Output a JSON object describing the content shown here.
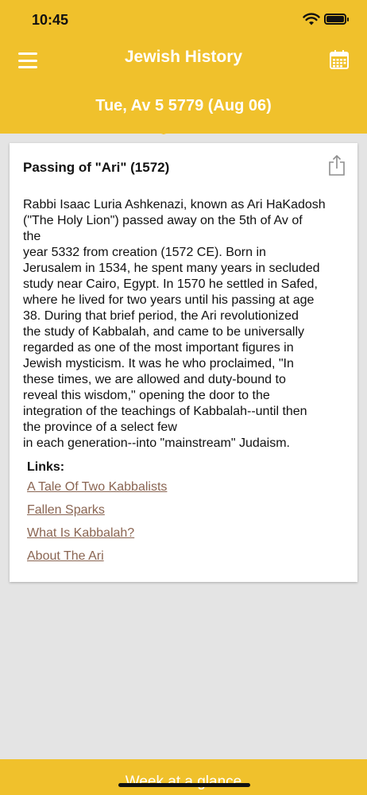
{
  "status_bar": {
    "time": "10:45"
  },
  "header": {
    "title": "Jewish History",
    "date": "Tue, Av 5 5779 (Aug 06)"
  },
  "card": {
    "title": "Passing of \"Ari\" (1572)",
    "body_lines": [
      "Rabbi Isaac Luria Ashkenazi, known as Ari HaKadosh",
      "(\"The Holy Lion\") passed away on the 5th of Av of",
      "the",
      "year 5332 from creation (1572 CE). Born in",
      "Jerusalem in 1534, he spent many years in secluded",
      "study near Cairo, Egypt. In 1570 he settled in Safed,",
      "where he lived for two years until his passing at age",
      "38. During that brief period, the Ari revolutionized",
      "the study of Kabbalah, and came to be universally",
      "regarded as one of the most important figures in",
      "Jewish mysticism. It was he who proclaimed, \"In",
      "these times, we are allowed and duty-bound to",
      "reveal this wisdom,\" opening the door to the",
      "integration of the teachings of Kabbalah--until then",
      "the province of a select few",
      "in each generation--into \"mainstream\" Judaism."
    ],
    "links_heading": "Links:",
    "links": [
      "A Tale Of Two Kabbalists",
      "Fallen Sparks",
      "What Is Kabbalah?",
      "About The Ari"
    ]
  },
  "bottom_bar": {
    "label": "Week at a glance"
  },
  "icons": {
    "menu": "hamburger-menu-icon",
    "calendar": "calendar-icon",
    "share": "share-icon",
    "wifi": "wifi-icon",
    "battery": "battery-icon"
  },
  "colors": {
    "accent": "#f0c12c",
    "link": "#8a6552",
    "background": "#e4e4e4"
  }
}
